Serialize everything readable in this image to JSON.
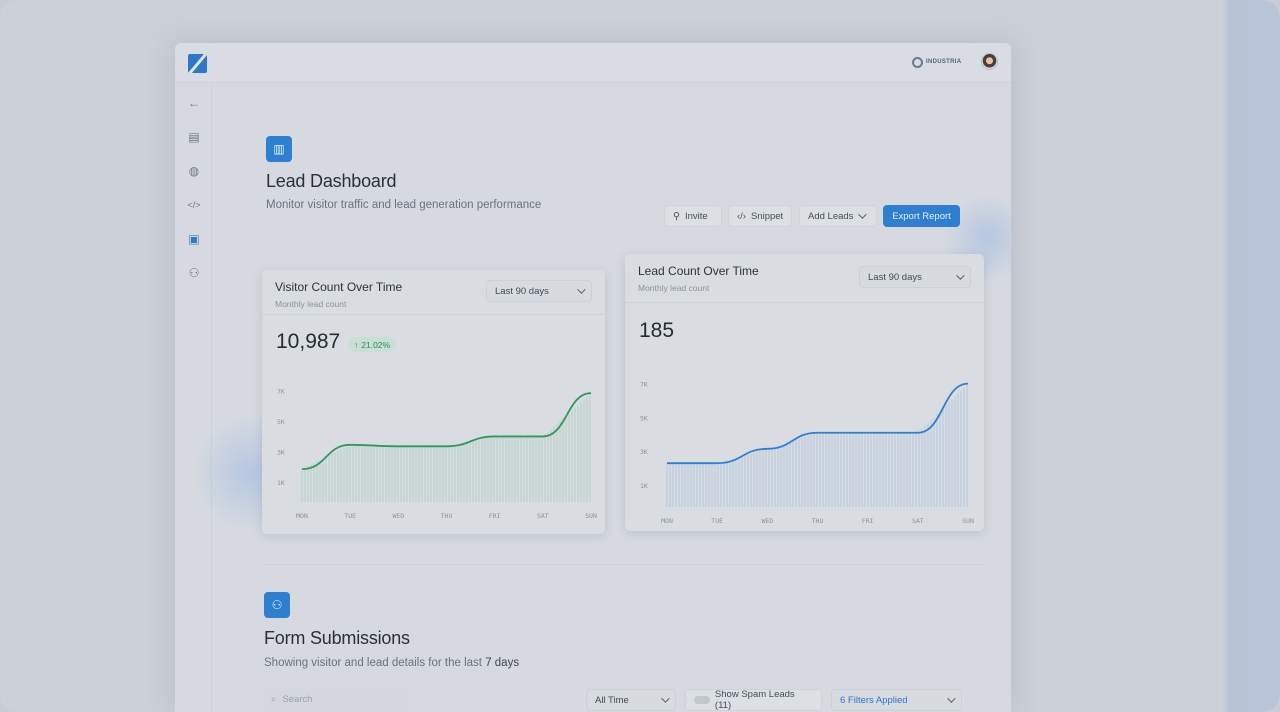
{
  "header": {
    "brand": "INDUSTRIA"
  },
  "sidebar": {
    "items": [
      {
        "name": "back-icon",
        "glyph": "←"
      },
      {
        "name": "table-icon",
        "glyph": "▤"
      },
      {
        "name": "globe-icon",
        "glyph": "◍"
      },
      {
        "name": "code-icon",
        "glyph": "</>"
      },
      {
        "name": "presentation-icon",
        "glyph": "▣"
      },
      {
        "name": "users-icon",
        "glyph": "⚇"
      }
    ]
  },
  "dashboard": {
    "title": "Lead Dashboard",
    "subtitle": "Monitor visitor traffic and lead generation performance",
    "invite_label": "Invite",
    "snippet_label": "Snippet",
    "add_leads_label": "Add Leads",
    "export_label": "Export Report"
  },
  "visitor_card": {
    "title": "Visitor Count Over Time",
    "subtitle": "Monthly lead count",
    "range": "Last 90 days",
    "total": "10,987",
    "change": "21.02%"
  },
  "lead_card": {
    "title": "Lead Count Over Time",
    "subtitle": "Monthly lead count",
    "range": "Last 90 days",
    "total": "185"
  },
  "chart_data": [
    {
      "type": "area",
      "x": [
        "MON",
        "TUE",
        "WED",
        "THU",
        "FRI",
        "SAT",
        "SUN"
      ],
      "yticks": [
        "7K",
        "5K",
        "3K",
        "1K"
      ],
      "ylim": [
        0,
        7500
      ],
      "series": [
        {
          "values": [
            1900,
            3500,
            3400,
            3400,
            4050,
            4050,
            6900
          ]
        }
      ],
      "color": "#2e9a5c"
    },
    {
      "type": "area",
      "x": [
        "MON",
        "TUE",
        "WED",
        "THU",
        "FRI",
        "SAT",
        "SUN"
      ],
      "yticks": [
        "7K",
        "5K",
        "3K",
        "1K"
      ],
      "ylim": [
        0,
        7500
      ],
      "series": [
        {
          "values": [
            2350,
            2350,
            3200,
            4150,
            4150,
            4150,
            7050
          ]
        }
      ],
      "color": "#2f7fd0"
    }
  ],
  "forms": {
    "title": "Form Submissions",
    "subtitle_prefix": "Showing visitor and lead details for the last",
    "subtitle_period": "7 days",
    "search_placeholder": "Search",
    "time_filter": "All Time",
    "spam_label": "Show Spam Leads (11)",
    "filters_label": "6 Filters Applied"
  }
}
